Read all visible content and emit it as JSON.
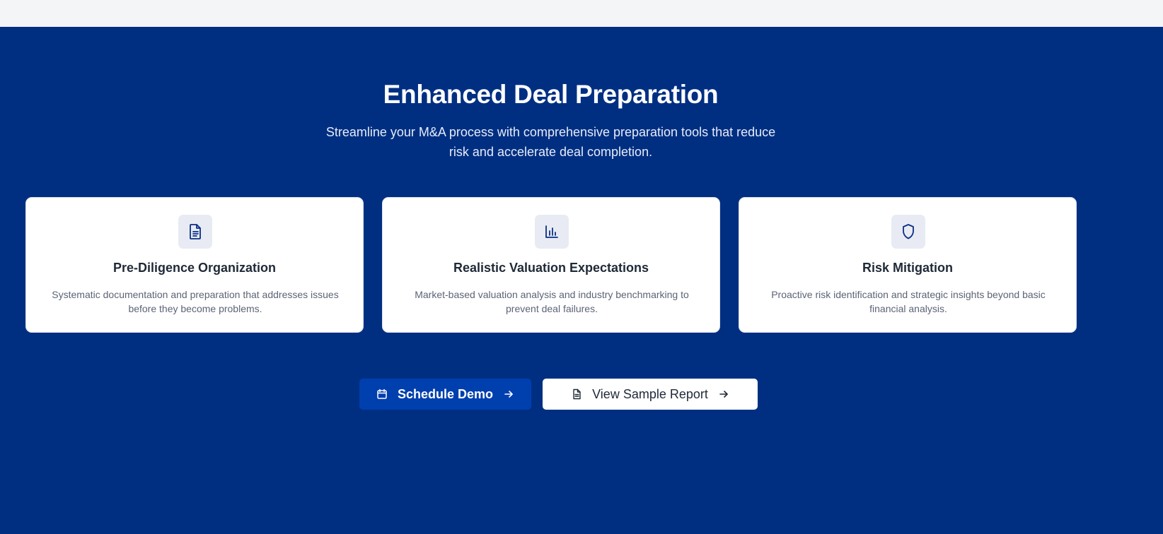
{
  "hero": {
    "title": "Enhanced Deal Preparation",
    "subtitle": "Streamline your M&A process with comprehensive preparation tools that reduce risk and accelerate deal completion."
  },
  "cards": [
    {
      "icon": "document-icon",
      "title": "Pre-Diligence Organization",
      "description": "Systematic documentation and preparation that addresses issues before they become problems."
    },
    {
      "icon": "bar-chart-icon",
      "title": "Realistic Valuation Expectations",
      "description": "Market-based valuation analysis and industry benchmarking to prevent deal failures."
    },
    {
      "icon": "shield-icon",
      "title": "Risk Mitigation",
      "description": "Proactive risk identification and strategic insights beyond basic financial analysis."
    }
  ],
  "actions": {
    "primary": {
      "label": "Schedule Demo",
      "icon": "calendar-icon",
      "trailing_icon": "arrow-right-icon"
    },
    "secondary": {
      "label": "View Sample Report",
      "icon": "document-icon",
      "trailing_icon": "arrow-right-icon"
    }
  },
  "colors": {
    "hero_background": "#002f82",
    "primary_button": "#003fae",
    "card_background": "#ffffff",
    "icon_tile": "#e8ebf3",
    "icon_stroke": "#0b2f86"
  }
}
